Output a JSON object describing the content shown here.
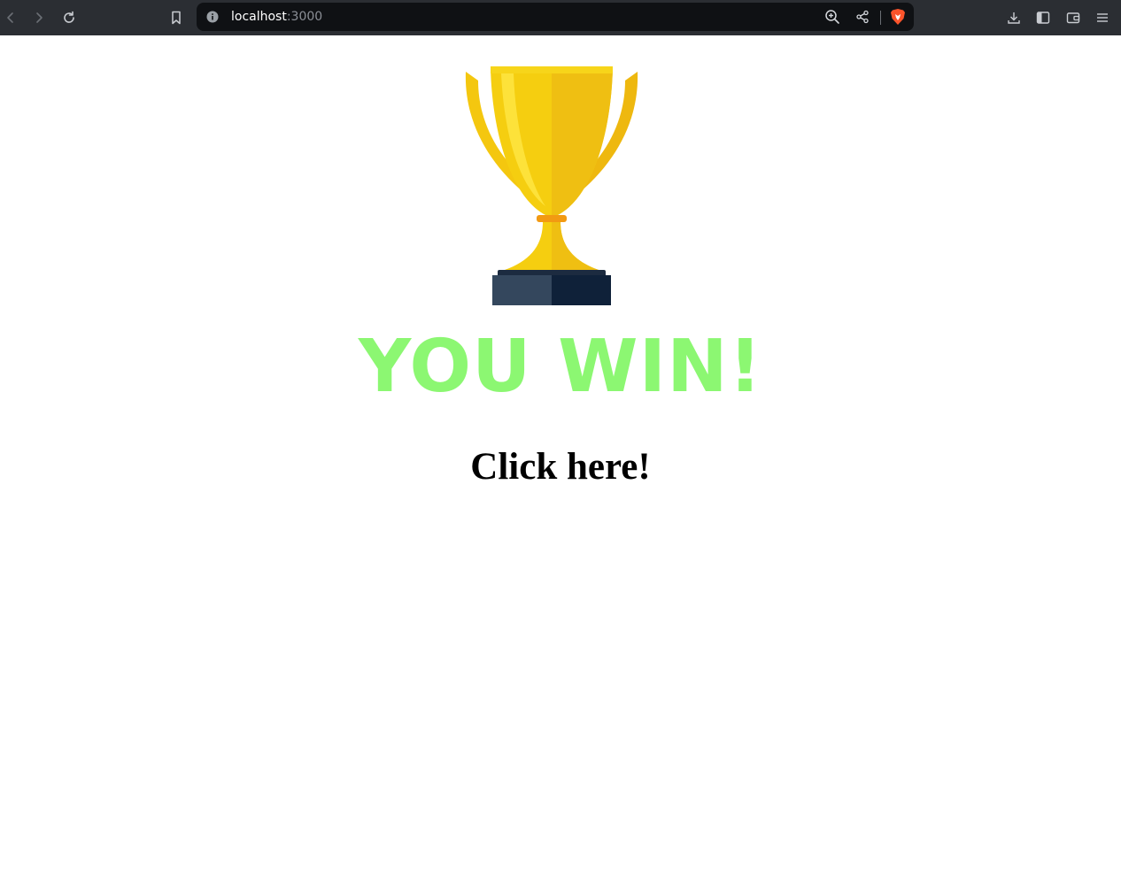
{
  "browser": {
    "url_host": "localhost",
    "url_port": ":3000",
    "icons": {
      "back": "chevron-left-icon",
      "forward": "chevron-right-icon",
      "reload": "reload-icon",
      "bookmark": "bookmark-icon",
      "site_info": "info-icon",
      "zoom": "zoom-in-icon",
      "share": "share-icon",
      "brave": "brave-shield-icon",
      "downloads": "download-icon",
      "sidebar": "sidebar-icon",
      "wallet": "wallet-icon",
      "menu": "menu-icon"
    }
  },
  "page": {
    "banner_text": "YOU WIN!",
    "link_text": "Click here!",
    "colors": {
      "banner": "#8cf772",
      "trophy_gold": "#f2c511",
      "trophy_base": "#0f2139"
    }
  }
}
